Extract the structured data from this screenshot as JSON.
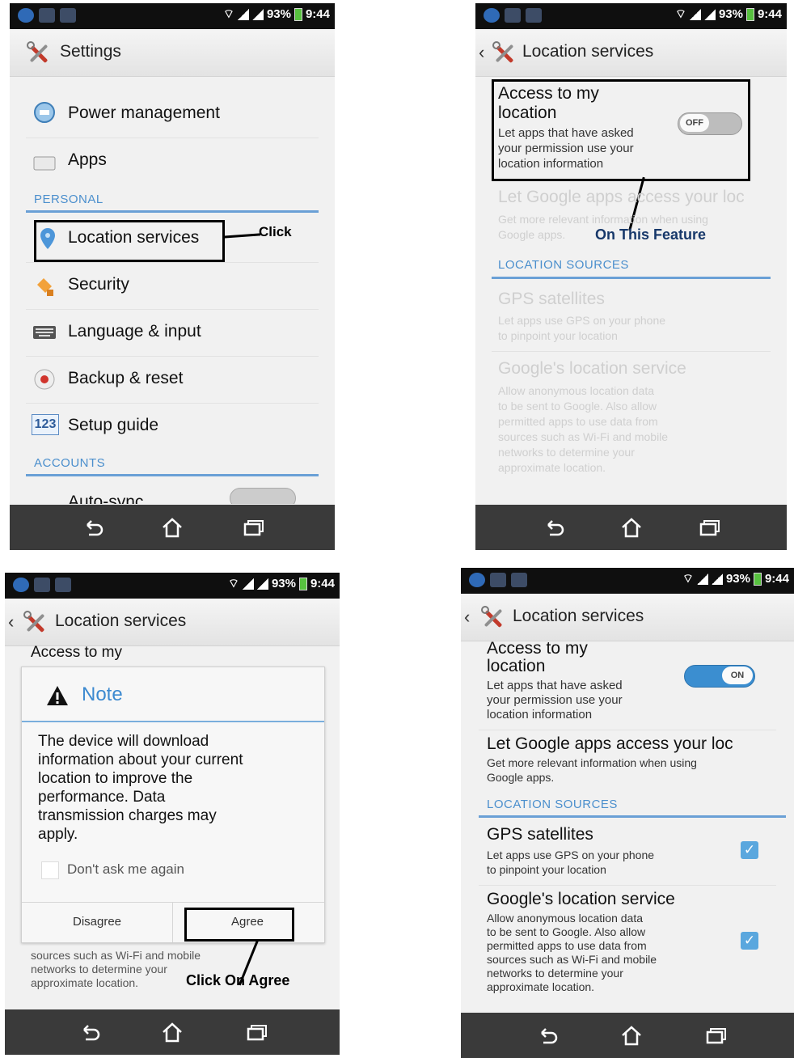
{
  "status_bar": {
    "battery": "93%",
    "time": "9:44"
  },
  "panel1": {
    "title": "Settings",
    "items": [
      {
        "label": "Power management",
        "icon": "power-management-icon"
      },
      {
        "label": "Apps",
        "icon": "apps-icon"
      }
    ],
    "section_personal": "PERSONAL",
    "personal_items": [
      {
        "label": "Location services",
        "icon": "location-pin-icon"
      },
      {
        "label": "Security",
        "icon": "security-icon"
      },
      {
        "label": "Language & input",
        "icon": "keyboard-icon"
      },
      {
        "label": "Backup & reset",
        "icon": "backup-icon"
      },
      {
        "label": "Setup guide",
        "icon": "setup-guide-icon",
        "icon_text": "123"
      }
    ],
    "section_accounts": "ACCOUNTS",
    "partial_item": "Auto-sync",
    "annotation": "Click"
  },
  "panel2": {
    "title": "Location services",
    "access": {
      "title_line1": "Access to my",
      "title_line2": "location",
      "sub_line1": "Let apps that have asked",
      "sub_line2": "your permission use your",
      "sub_line3": "location information",
      "toggle": "OFF"
    },
    "google_apps": {
      "title": "Let Google apps access your loc",
      "sub_line1": "Get more relevant information when using",
      "sub_line2": "Google apps."
    },
    "annotation": "On This Feature",
    "section": "LOCATION SOURCES",
    "gps": {
      "title": "GPS satellites",
      "sub_line1": "Let apps use GPS on your phone",
      "sub_line2": "to pinpoint your location"
    },
    "google_loc": {
      "title": "Google's location service",
      "sub_lines": [
        "Allow anonymous location data",
        "to be sent to Google. Also allow",
        "permitted apps to use data from",
        "sources such as Wi-Fi and mobile",
        "networks to determine your",
        "approximate location."
      ]
    }
  },
  "panel3": {
    "title": "Location services",
    "bg_title_line1": "Access to my",
    "dialog": {
      "title": "Note",
      "body": [
        "The device will download",
        "information about your current",
        "location to improve the",
        "performance. Data",
        "transmission charges may",
        "apply."
      ],
      "checkbox_label": "Don't ask me again",
      "disagree": "Disagree",
      "agree": "Agree"
    },
    "bg_sub_lines": [
      "sources such as Wi-Fi and mobile",
      "networks to determine your",
      "approximate location."
    ],
    "annotation": "Click On Agree"
  },
  "panel4": {
    "title": "Location services",
    "access": {
      "title_line1": "Access to my",
      "title_line2": "location",
      "sub_line1": "Let apps that have asked",
      "sub_line2": "your permission use your",
      "sub_line3": "location information",
      "toggle": "ON"
    },
    "google_apps": {
      "title": "Let Google apps access your loc",
      "sub_line1": "Get more relevant information when using",
      "sub_line2": "Google apps."
    },
    "section": "LOCATION SOURCES",
    "gps": {
      "title": "GPS satellites",
      "sub_line1": "Let apps use GPS on your phone",
      "sub_line2": "to pinpoint your location"
    },
    "google_loc": {
      "title": "Google's location service",
      "sub_lines": [
        "Allow anonymous location data",
        "to be sent to Google. Also allow",
        "permitted apps to use data from",
        "sources such as Wi-Fi and mobile",
        "networks to determine your",
        "approximate location."
      ]
    }
  },
  "colors": {
    "accent": "#4b8fcd",
    "checkbox": "#5aa7de",
    "toggle_on": "#3b8ed0",
    "navbar": "#3a3a3a",
    "status_bar": "#0f0f0f"
  }
}
